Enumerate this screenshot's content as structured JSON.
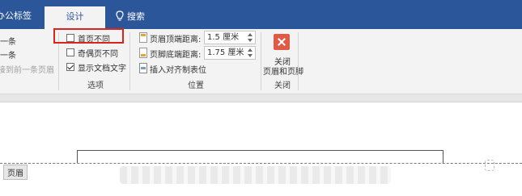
{
  "titlebar": {
    "left_tab_label": "办公标签",
    "design_tab_label": "设计",
    "tell_me_label": "搜索",
    "colors": {
      "accent": "#2b579a",
      "ribbon_bg": "#f3f3f3",
      "highlight": "#d9261c",
      "close_icon": "#e05a45"
    }
  },
  "ribbon": {
    "nav": {
      "prev_label": "一条",
      "next_label": "一条",
      "link_label": "接到前一条页眉"
    },
    "options": {
      "group_label": "选项",
      "items": [
        {
          "label": "首页不同",
          "checked": false
        },
        {
          "label": "奇偶页不同",
          "checked": false
        },
        {
          "label": "显示文档文字",
          "checked": true
        }
      ]
    },
    "position": {
      "group_label": "位置",
      "header_top_label": "页眉顶端距离:",
      "header_top_value": "1.5 厘米",
      "footer_bottom_label": "页脚底端距离:",
      "footer_bottom_value": "1.75 厘米",
      "insert_tab_label": "插入对齐制表位"
    },
    "close": {
      "group_label": "关闭",
      "button_label_line1": "关闭",
      "button_label_line2": "页眉和页脚"
    }
  },
  "document": {
    "header_tag": "页眉"
  },
  "icons": [
    "lightbulb-icon",
    "header-position-icon",
    "footer-position-icon",
    "insert-tab-icon",
    "close-icon"
  ]
}
